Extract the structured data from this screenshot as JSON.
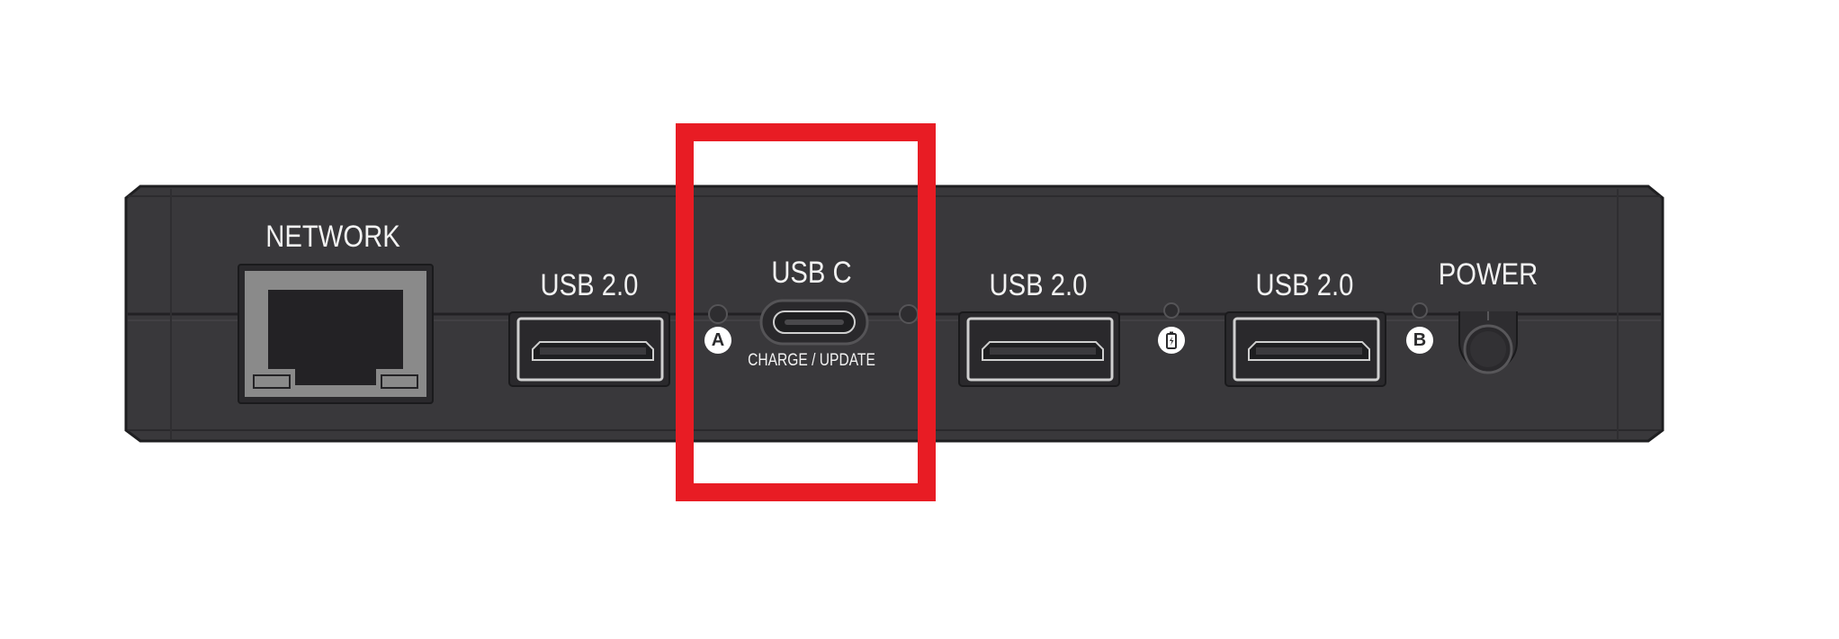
{
  "device": {
    "ports": {
      "network": "NETWORK",
      "usb_1": "USB 2.0",
      "usb_c": "USB C",
      "usb_c_caption": "CHARGE / UPDATE",
      "usb_2": "USB 2.0",
      "usb_3": "USB 2.0",
      "power": "POWER"
    },
    "indicators": {
      "a": "A",
      "b": "B",
      "battery_icon": "battery-icon"
    }
  },
  "highlight": {
    "target": "usb-c-port",
    "color": "#e81c24"
  },
  "colors": {
    "housing": "#39383b",
    "housing_edge": "#1f1f21",
    "port_fill": "#2a292c",
    "ethernet_frame": "#8a8a8a",
    "label": "#f2f2f2"
  }
}
